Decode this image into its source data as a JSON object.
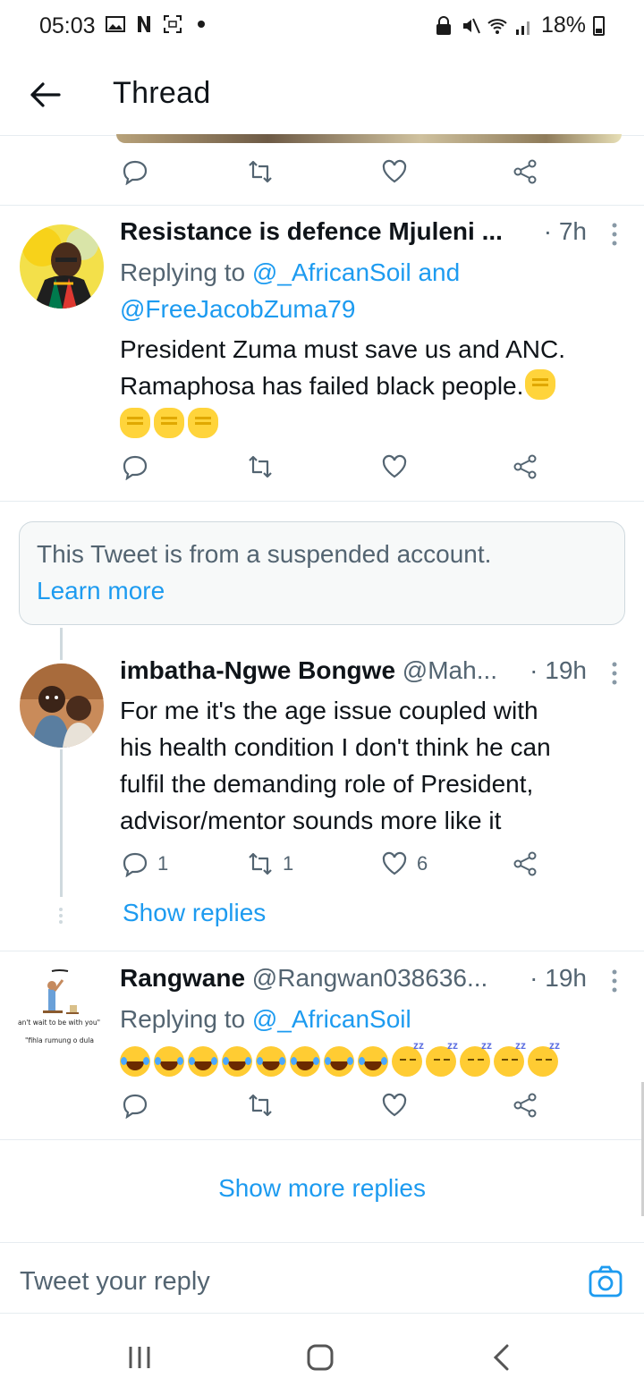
{
  "status": {
    "time": "05:03",
    "battery": "18%"
  },
  "header": {
    "title": "Thread"
  },
  "colors": {
    "accent": "#1d9bf0",
    "secondary_text": "#536471",
    "primary_text": "#0f1419"
  },
  "tweets": [
    {
      "name": "Resistance is defence Mjuleni ...",
      "handle": "",
      "time": "· 7h",
      "reply_prefix": "Replying to ",
      "reply_to_1": "@_AfricanSoil and",
      "reply_to_2": "@FreeJacobZuma79",
      "text_line1": "President Zuma must save us and ANC.",
      "text_line2": "Ramaphosa has failed black people.",
      "emoji": "raised-fist"
    },
    {
      "name": "imbatha-Ngwe Bongwe",
      "handle": " @Mah...",
      "time": "· 19h",
      "text_line1": "For me it's the age issue coupled with",
      "text_line2": "his health condition I don't think he can",
      "text_line3": "fulfil the demanding role of President,",
      "text_line4": "advisor/mentor sounds more like it",
      "reply_count": "1",
      "retweet_count": "1",
      "like_count": "6",
      "show_replies": "Show replies"
    },
    {
      "name": "Rangwane",
      "handle": " @Rangwan038636...",
      "time": "· 19h",
      "reply_prefix": "Replying to ",
      "reply_to_1": "@_AfricanSoil",
      "avatar_text_1": "an't wait to be with you\"",
      "avatar_text_2": "\"fihla rumung o dula",
      "emoji": "tears-of-joy, sleeping"
    }
  ],
  "suspended": {
    "message": "This Tweet is from a suspended account.",
    "learn_more": "Learn more"
  },
  "show_more": "Show more replies",
  "composer": {
    "placeholder": "Tweet your reply"
  },
  "icons": {
    "reply": "reply-icon",
    "retweet": "retweet-icon",
    "like": "heart-icon",
    "share": "share-icon"
  }
}
